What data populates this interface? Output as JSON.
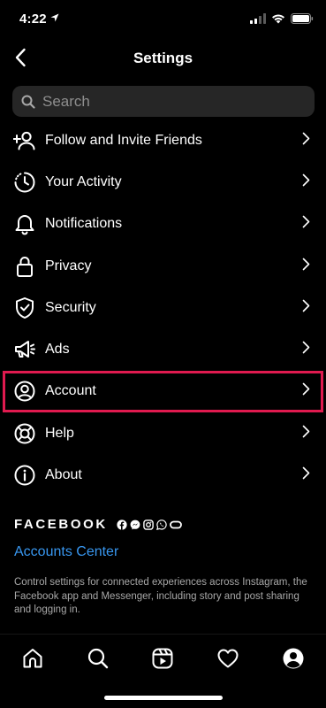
{
  "status_bar": {
    "time": "4:22"
  },
  "header": {
    "title": "Settings"
  },
  "search": {
    "placeholder": "Search"
  },
  "menu": {
    "items": [
      {
        "label": "Follow and Invite Friends",
        "icon": "add-person-icon"
      },
      {
        "label": "Your Activity",
        "icon": "activity-clock-icon"
      },
      {
        "label": "Notifications",
        "icon": "bell-icon"
      },
      {
        "label": "Privacy",
        "icon": "lock-icon"
      },
      {
        "label": "Security",
        "icon": "shield-check-icon"
      },
      {
        "label": "Ads",
        "icon": "megaphone-icon"
      },
      {
        "label": "Account",
        "icon": "account-circle-icon",
        "highlighted": true
      },
      {
        "label": "Help",
        "icon": "lifebuoy-icon"
      },
      {
        "label": "About",
        "icon": "info-icon"
      }
    ]
  },
  "facebook": {
    "wordmark": "FACEBOOK",
    "accounts_center_label": "Accounts Center",
    "description": "Control settings for connected experiences across Instagram, the Facebook app and Messenger, including story and post sharing and logging in."
  },
  "tab_bar": {
    "tabs": [
      "home-icon",
      "search-icon",
      "reels-icon",
      "heart-icon",
      "profile-icon"
    ]
  },
  "colors": {
    "background": "#000000",
    "link": "#3897f0",
    "highlight_border": "#e01a4f",
    "search_bg": "#262626"
  }
}
